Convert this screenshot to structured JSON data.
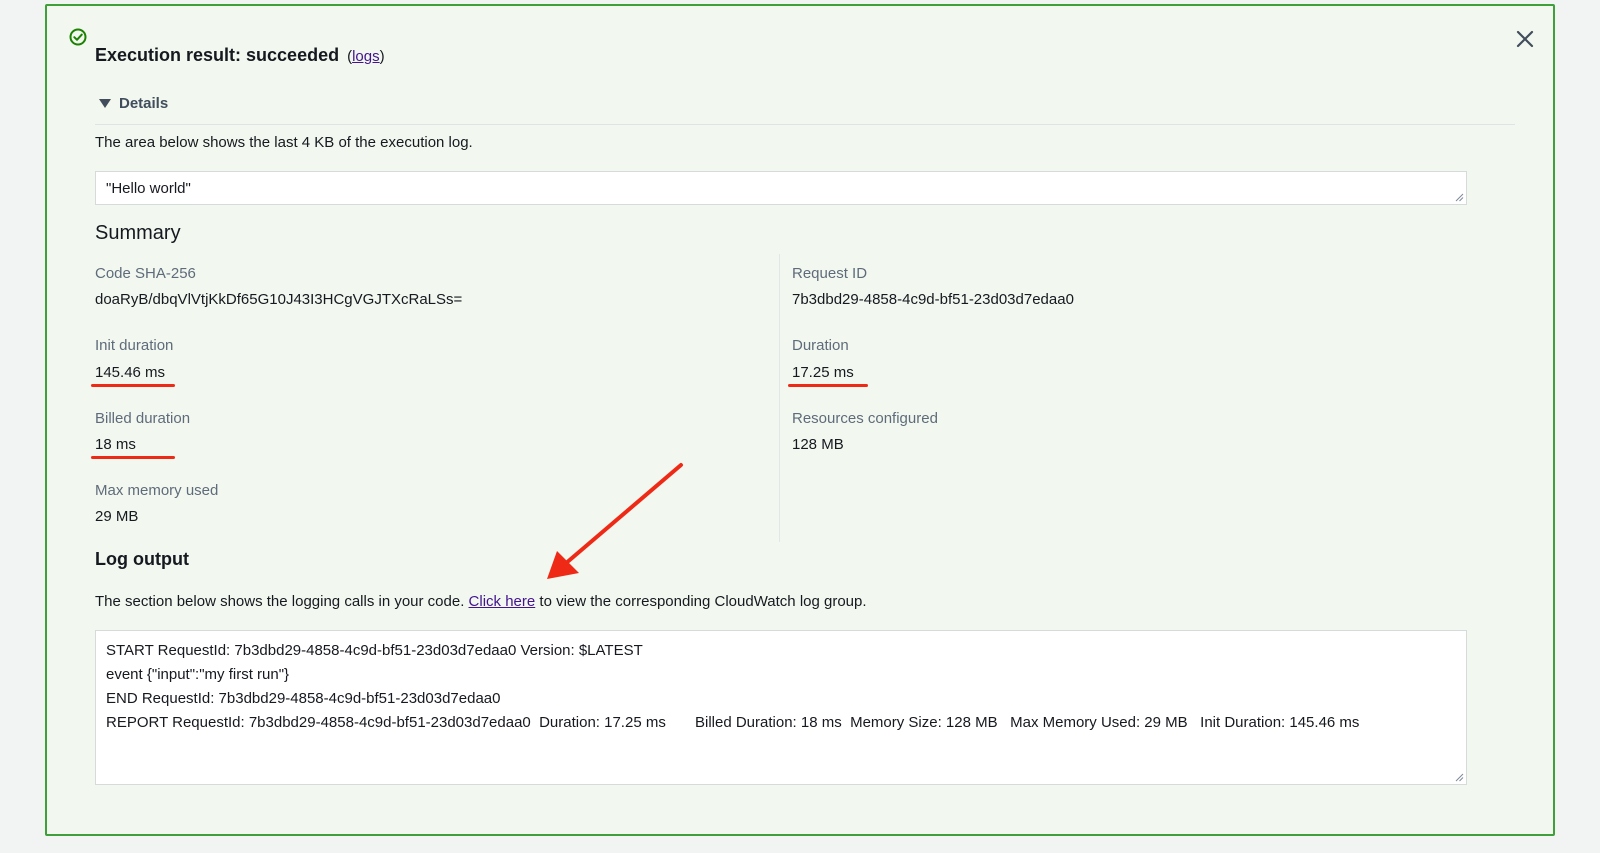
{
  "result": {
    "title": "Execution result: succeeded",
    "paren_open": "(",
    "logs_link": "logs",
    "paren_close": ")",
    "details_label": "Details",
    "description": "The area below shows the last 4 KB of the execution log.",
    "output_value": "\"Hello world\""
  },
  "summary": {
    "heading": "Summary",
    "code_sha_label": "Code SHA-256",
    "code_sha_value": "doaRyB/dbqVlVtjKkDf65G10J43I3HCgVGJTXcRaLSs=",
    "request_id_label": "Request ID",
    "request_id_value": "7b3dbd29-4858-4c9d-bf51-23d03d7edaa0",
    "init_duration_label": "Init duration",
    "init_duration_value": "145.46 ms",
    "duration_label": "Duration",
    "duration_value": "17.25 ms",
    "billed_duration_label": "Billed duration",
    "billed_duration_value": "18 ms",
    "resources_label": "Resources configured",
    "resources_value": "128 MB",
    "max_memory_label": "Max memory used",
    "max_memory_value": "29 MB"
  },
  "log_output": {
    "heading": "Log output",
    "desc_before": "The section below shows the logging calls in your code.",
    "click_here": "Click here",
    "desc_after": "to view the corresponding CloudWatch log group.",
    "lines": [
      "START RequestId: 7b3dbd29-4858-4c9d-bf51-23d03d7edaa0 Version: $LATEST",
      "event {\"input\":\"my first run\"}",
      "END RequestId: 7b3dbd29-4858-4c9d-bf51-23d03d7edaa0",
      "REPORT RequestId: 7b3dbd29-4858-4c9d-bf51-23d03d7edaa0  Duration: 17.25 ms       Billed Duration: 18 ms  Memory Size: 128 MB   Max Memory Used: 29 MB   Init Duration: 145.46 ms"
    ]
  },
  "icons": {
    "success": "check-circle-icon",
    "close": "close-icon",
    "expand": "caret-down-icon",
    "resize": "resize-handle-icon"
  },
  "colors": {
    "success_green": "#3f9f3b",
    "annotation_red": "#ee2a16",
    "link_purple": "#44148f"
  }
}
